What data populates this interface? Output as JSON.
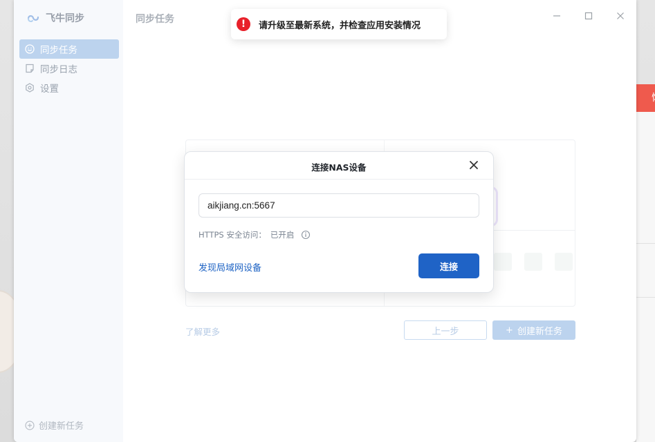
{
  "app": {
    "name": "飞牛同步",
    "page_title": "同步任务"
  },
  "sidebar": {
    "items": [
      {
        "label": "同步任务",
        "icon": "smile-icon",
        "active": true
      },
      {
        "label": "同步日志",
        "icon": "note-icon",
        "active": false
      },
      {
        "label": "设置",
        "icon": "gear-icon",
        "active": false
      }
    ],
    "footer_label": "创建新任务"
  },
  "toast": {
    "message": "请升级至最新系统，并检查应用安装情况",
    "icon_glyph": "!",
    "color": "#e8202a"
  },
  "dialog": {
    "title": "连接NAS设备",
    "address_value": "aikjiang.cn:5667",
    "https_label": "HTTPS 安全访问：",
    "https_value": "已开启",
    "discover_label": "发现局域网设备",
    "connect_label": "连接"
  },
  "background": {
    "learn_more": "了解更多",
    "prev_label": "上一步",
    "create_label": "创建新任务",
    "create_glyph": "+"
  },
  "desktop": {
    "red_tab_glyph": "恢"
  },
  "colors": {
    "accent": "#1f63c6",
    "sidebar_active": "#bcd3ee"
  }
}
